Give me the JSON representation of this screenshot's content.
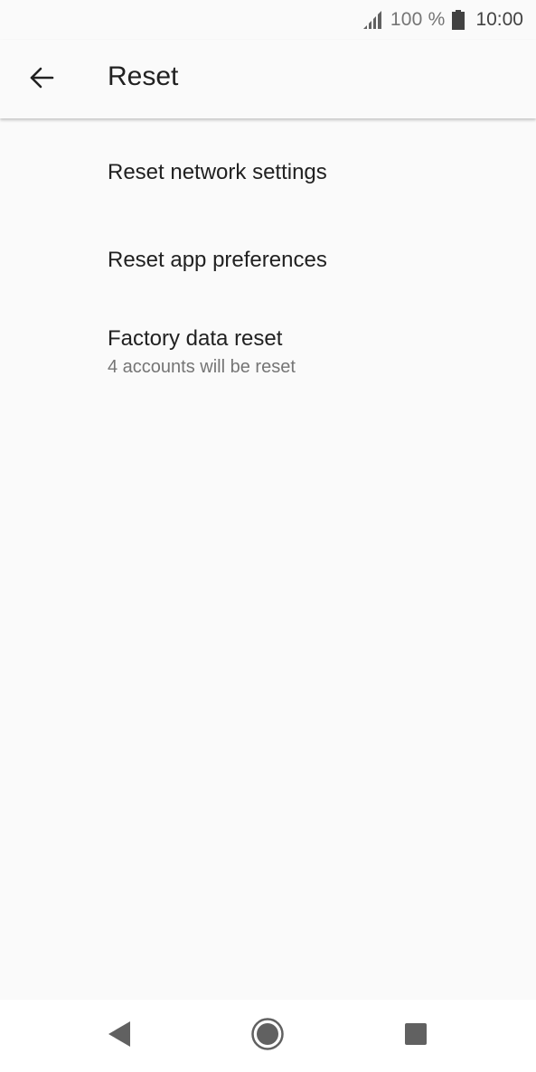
{
  "status_bar": {
    "icons": [
      "signal-icon",
      "battery-icon"
    ],
    "battery_percent": "100 %",
    "clock": "10:00"
  },
  "app_bar": {
    "back_icon": "arrow-left-icon",
    "title": "Reset"
  },
  "list": {
    "items": [
      {
        "title": "Reset network settings"
      },
      {
        "title": "Reset app preferences"
      },
      {
        "title": "Factory data reset",
        "subtitle": "4 accounts will be reset"
      }
    ]
  },
  "nav_bar": {
    "icons": [
      "nav-back-icon",
      "nav-home-icon",
      "nav-recents-icon"
    ]
  },
  "colors": {
    "background": "#fafafa",
    "text_primary": "#212121",
    "text_secondary": "#757575",
    "nav_background": "#ffffff",
    "icon": "#616161"
  }
}
